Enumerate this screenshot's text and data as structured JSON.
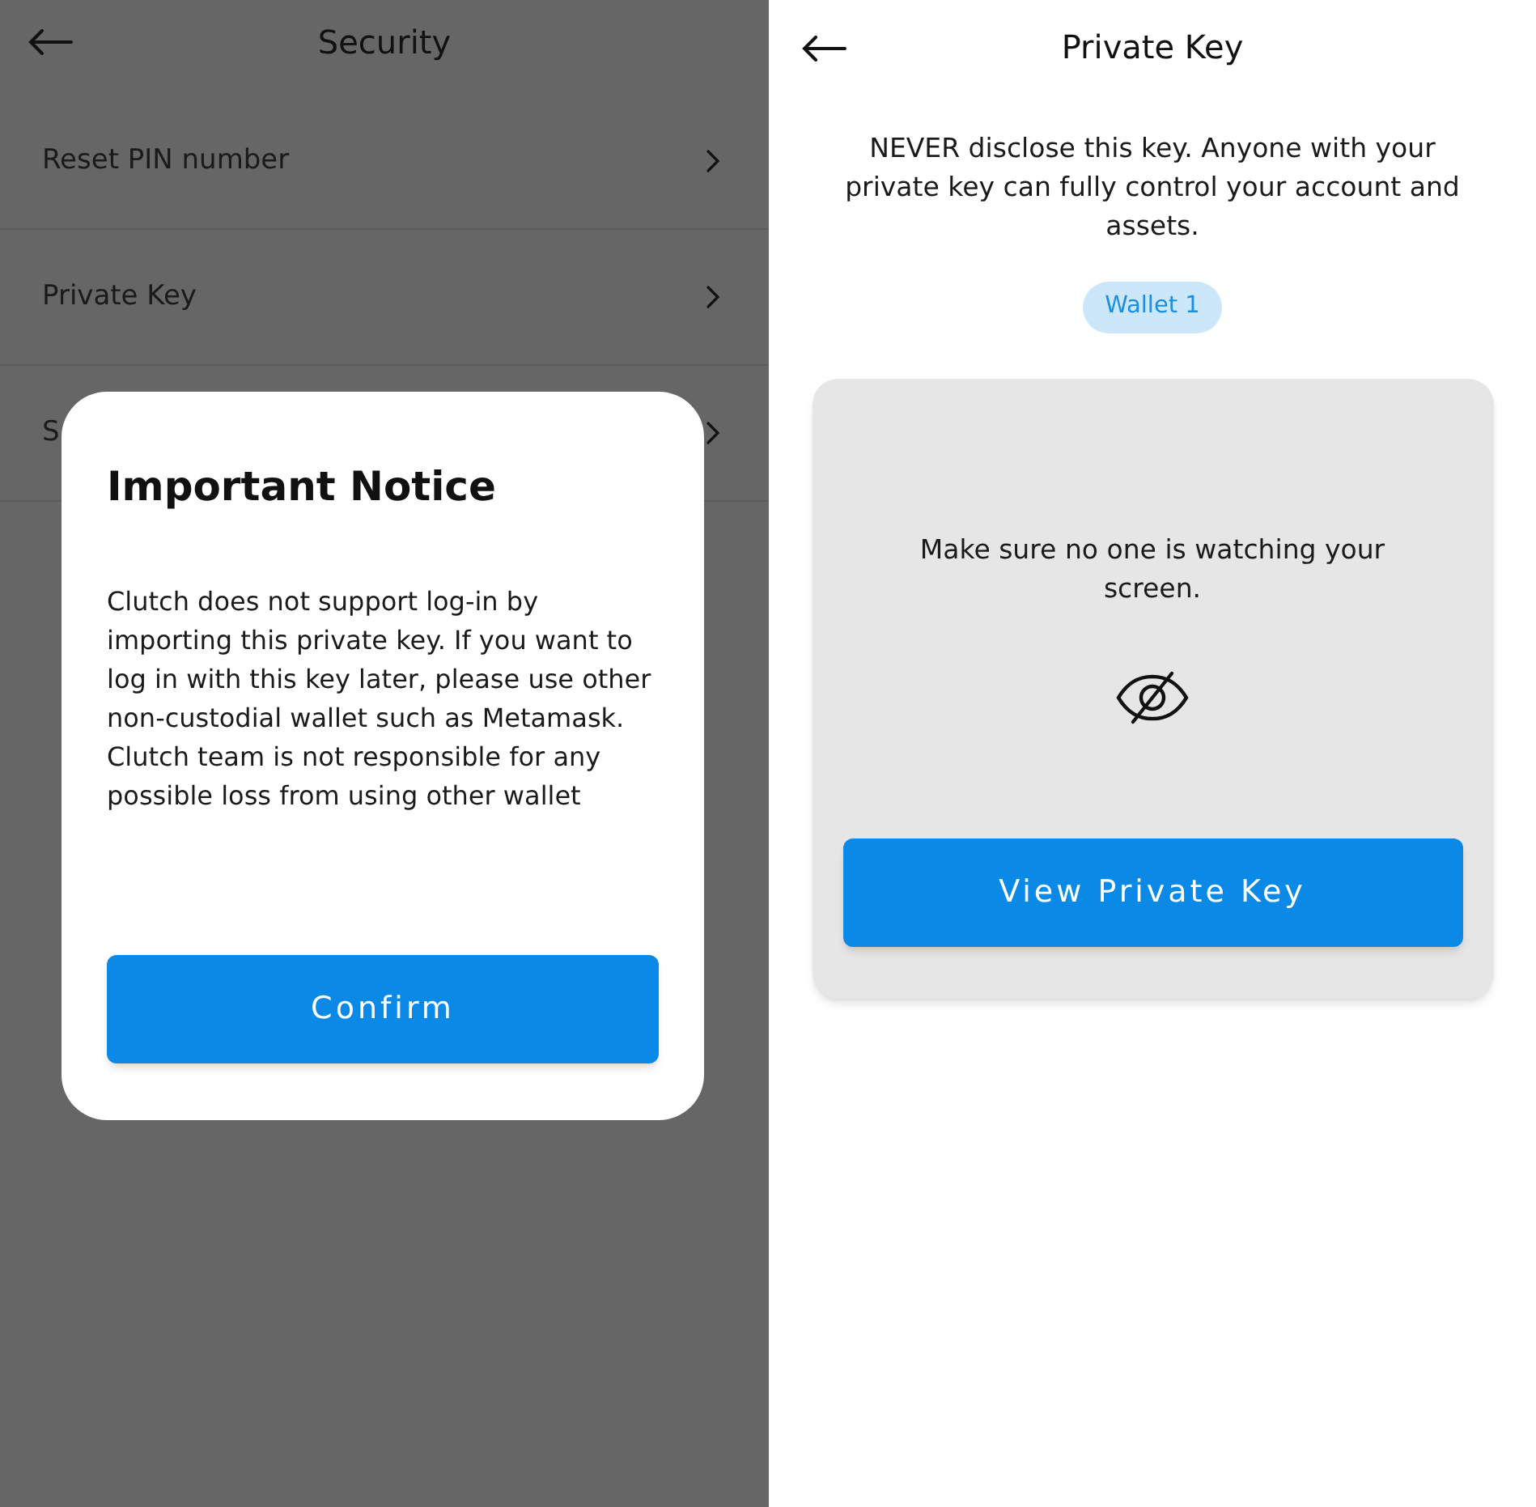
{
  "security_screen": {
    "title": "Security",
    "menu_items": [
      {
        "label": "Reset PIN number"
      },
      {
        "label": "Private Key"
      },
      {
        "label": "S"
      }
    ]
  },
  "notice_dialog": {
    "title": "Important Notice",
    "message": "Clutch does not support log-in by importing this private key. If you want to log in with this key later, please use other non-custodial wallet such as Metamask. Clutch team is not responsible for any possible loss from using other wallet",
    "confirm_button": "Confirm"
  },
  "private_key_screen": {
    "title": "Private Key",
    "warning": "NEVER disclose this key. Anyone with your private key can fully control your account and assets.",
    "wallet_badge": "Wallet 1",
    "card": {
      "message": "Make sure no one is watching your screen.",
      "button": "View Private Key"
    }
  }
}
